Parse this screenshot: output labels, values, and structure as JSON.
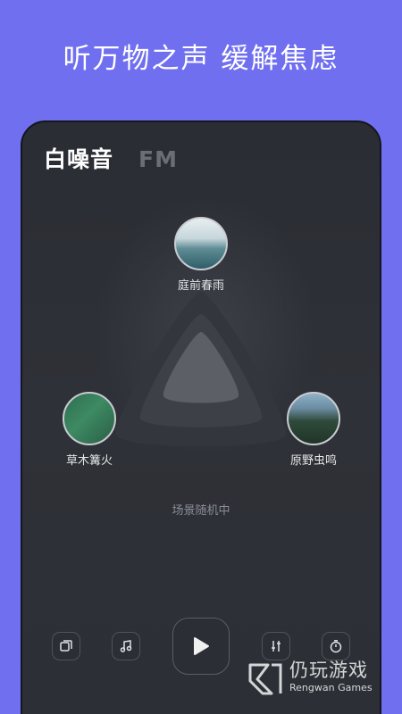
{
  "headline": "听万物之声  缓解焦虑",
  "tabs": [
    {
      "label": "白噪音",
      "active": true
    },
    {
      "label": "FM",
      "active": false
    }
  ],
  "scenes": [
    {
      "label": "庭前春雨",
      "icon": "rain-image"
    },
    {
      "label": "草木篝火",
      "icon": "campfire-image"
    },
    {
      "label": "原野虫鸣",
      "icon": "insects-image"
    }
  ],
  "status": "场景随机中",
  "controls": {
    "left1": "layers-icon",
    "left2": "music-note-icon",
    "play": "play-icon",
    "right1": "equalizer-icon",
    "right2": "timer-icon"
  },
  "watermark": {
    "name": "仍玩游戏",
    "sub": "Rengwan Games"
  },
  "colors": {
    "background": "#6f6ff0",
    "panel": "#2c2f35",
    "text": "#ffffff",
    "muted": "#6b6e74"
  }
}
